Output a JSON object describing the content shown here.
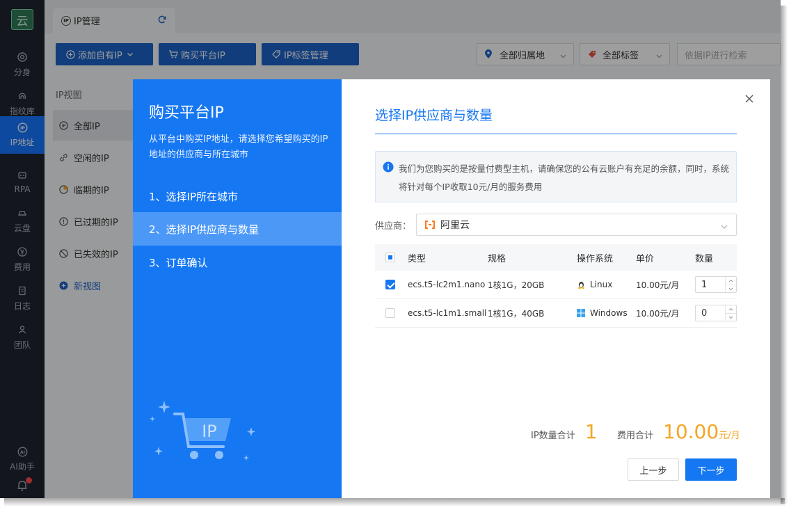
{
  "nav": {
    "logo": "云",
    "items": [
      {
        "label": "分身",
        "icon": "chrome-icon"
      },
      {
        "label": "指纹库",
        "icon": "fingerprint-icon"
      },
      {
        "label": "IP地址",
        "icon": "ip-icon"
      },
      {
        "label": "RPA",
        "icon": "robot-icon"
      },
      {
        "label": "云盘",
        "icon": "cloud-drive-icon"
      },
      {
        "label": "费用",
        "icon": "yen-icon"
      },
      {
        "label": "日志",
        "icon": "log-icon"
      },
      {
        "label": "团队",
        "icon": "team-icon"
      },
      {
        "label": "AI助手",
        "icon": "ai-icon"
      }
    ],
    "active_index": 2
  },
  "tab": {
    "label": "IP管理",
    "badge": "IP"
  },
  "toolbar": {
    "add_own_ip": "添加自有IP",
    "buy_platform_ip": "购买平台IP",
    "ip_tag_manage": "IP标签管理",
    "location_select": "全部归属地",
    "tag_select": "全部标签",
    "search_placeholder": "依据IP进行检索"
  },
  "side": {
    "title": "IP视图",
    "items": [
      "全部IP",
      "空闲的IP",
      "临期的IP",
      "已过期的IP",
      "已失效的IP"
    ],
    "new_view": "新视图"
  },
  "dialog": {
    "left_title": "购买平台IP",
    "left_desc": "从平台中购买IP地址，请选择您希望购买的IP地址的供应商与所在城市",
    "steps": [
      "1、选择IP所在城市",
      "2、选择IP供应商与数量",
      "3、订单确认"
    ],
    "cart_badge": "IP",
    "right_title": "选择IP供应商与数量",
    "notice": "我们为您购买的是按量付费型主机，请确保您的公有云账户有充足的余额，同时，系统将针对每个IP收取10元/月的服务费用",
    "provider_label": "供应商：",
    "provider_value": "阿里云",
    "table": {
      "headers": {
        "type": "类型",
        "spec": "规格",
        "os": "操作系统",
        "price": "单价",
        "qty": "数量"
      },
      "rows": [
        {
          "type": "ecs.t5-lc2m1.nano",
          "spec": "1核1G，20GB",
          "os": "Linux",
          "price": "10.00元/月",
          "qty": "1",
          "checked": true
        },
        {
          "type": "ecs.t5-lc1m1.small",
          "spec": "1核1G，40GB",
          "os": "Windows",
          "price": "10.00元/月",
          "qty": "0",
          "checked": false
        }
      ]
    },
    "summary": {
      "ip_count_label": "IP数量合计",
      "ip_count": "1",
      "fee_label": "费用合计",
      "fee": "10.00",
      "fee_unit": "元/月"
    },
    "prev_button": "上一步",
    "next_button": "下一步"
  },
  "colors": {
    "accent": "#1677f2",
    "nav_bg": "#1f2430",
    "highlight": "#f5a623"
  }
}
